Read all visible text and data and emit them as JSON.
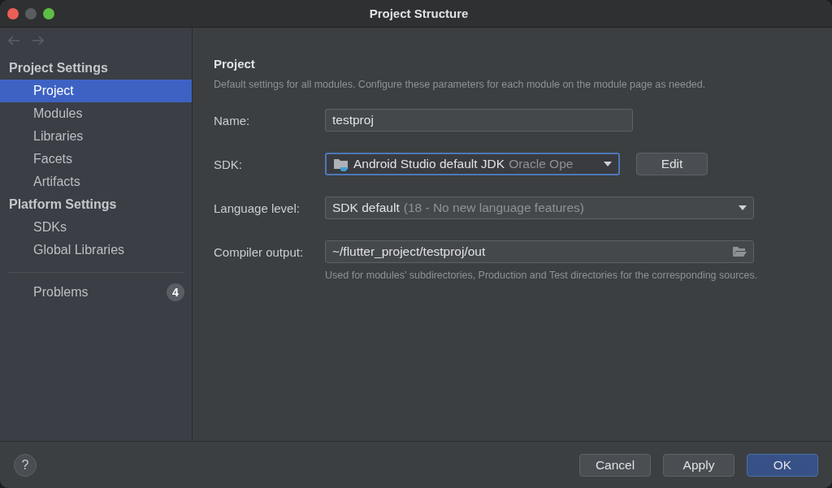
{
  "window": {
    "title": "Project Structure"
  },
  "sidebar": {
    "sections": [
      {
        "title": "Project Settings",
        "items": [
          {
            "label": "Project",
            "selected": true
          },
          {
            "label": "Modules",
            "selected": false
          },
          {
            "label": "Libraries",
            "selected": false
          },
          {
            "label": "Facets",
            "selected": false
          },
          {
            "label": "Artifacts",
            "selected": false
          }
        ]
      },
      {
        "title": "Platform Settings",
        "items": [
          {
            "label": "SDKs",
            "selected": false
          },
          {
            "label": "Global Libraries",
            "selected": false
          }
        ]
      }
    ],
    "problems": {
      "label": "Problems",
      "count": "4"
    }
  },
  "main": {
    "heading": "Project",
    "description": "Default settings for all modules. Configure these parameters for each module on the module page as needed.",
    "fields": [
      {
        "kind": "text",
        "label": "Name:",
        "value": "testproj",
        "focused": false
      },
      {
        "kind": "dropdown",
        "label": "SDK:",
        "value": "Android Studio default JDK",
        "detail": "Oracle Ope",
        "icon": true,
        "focused": true,
        "button": "Edit"
      },
      {
        "kind": "dropdown",
        "label": "Language level:",
        "value": "SDK default",
        "detail": "(18 - No new language features)",
        "icon": false,
        "focused": false
      },
      {
        "kind": "path",
        "label": "Compiler output:",
        "value": "~/flutter_project/testproj/out",
        "focused": false,
        "hint": "Used for modules' subdirectories, Production and Test directories for the corresponding sources."
      }
    ]
  },
  "footer": {
    "help": "?",
    "buttons": [
      {
        "label": "Cancel",
        "default": false
      },
      {
        "label": "Apply",
        "default": false
      },
      {
        "label": "OK",
        "default": true
      }
    ]
  }
}
